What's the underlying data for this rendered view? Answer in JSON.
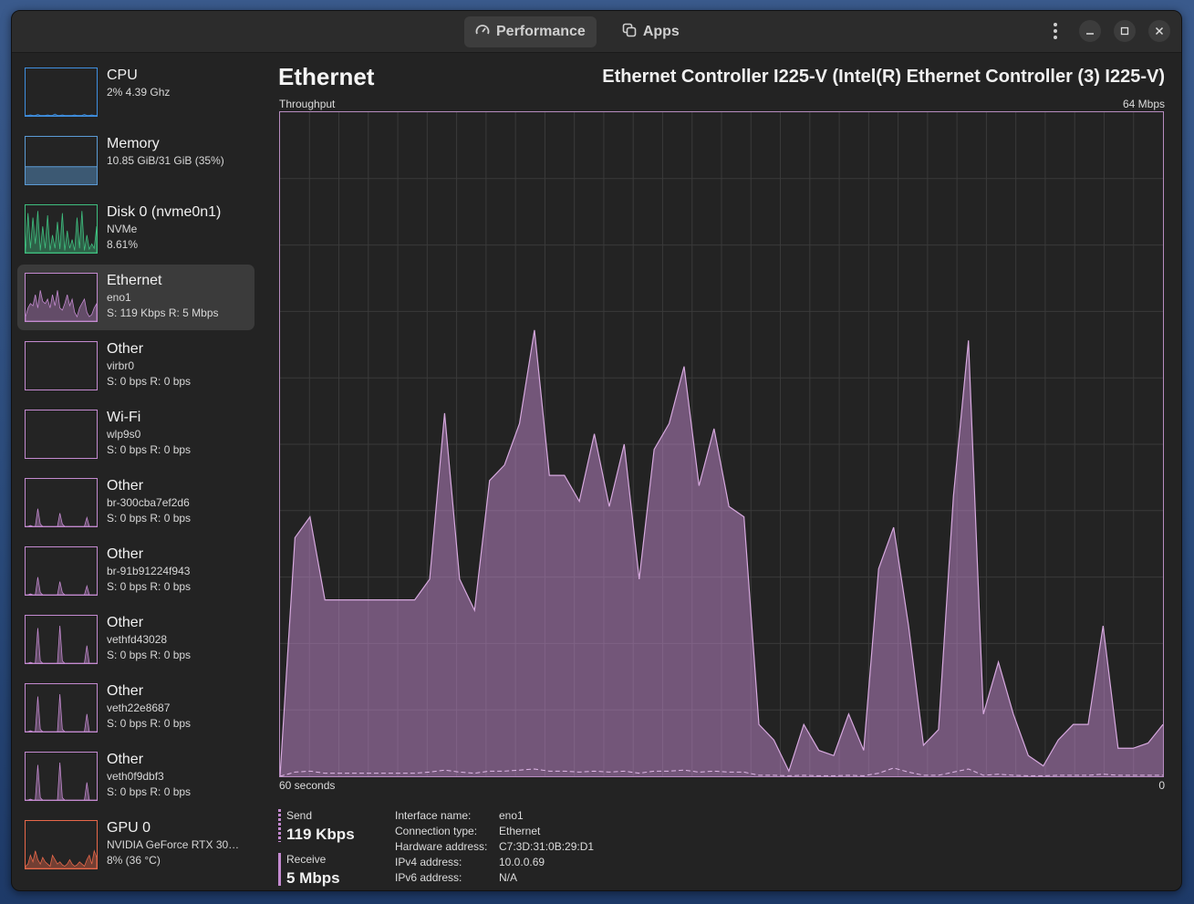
{
  "header": {
    "tabs": [
      {
        "label": "Performance",
        "icon": "gauge-icon",
        "active": true
      },
      {
        "label": "Apps",
        "icon": "apps-icon",
        "active": false
      }
    ]
  },
  "sidebar": {
    "items": [
      {
        "title": "CPU",
        "sub1": "2% 4.39 Ghz",
        "sub2": "",
        "color": "#3f8fe0"
      },
      {
        "title": "Memory",
        "sub1": "10.85 GiB/31 GiB (35%)",
        "sub2": "",
        "color": "#5b9bd5"
      },
      {
        "title": "Disk 0 (nvme0n1)",
        "sub1": "NVMe",
        "sub2": "8.61%",
        "color": "#3fbf7f"
      },
      {
        "title": "Ethernet",
        "sub1": "eno1",
        "sub2": "S: 119 Kbps R: 5 Mbps",
        "color": "#c48ad0"
      },
      {
        "title": "Other",
        "sub1": "virbr0",
        "sub2": "S: 0 bps R: 0 bps",
        "color": "#c48ad0"
      },
      {
        "title": "Wi-Fi",
        "sub1": "wlp9s0",
        "sub2": "S: 0 bps R: 0 bps",
        "color": "#c48ad0"
      },
      {
        "title": "Other",
        "sub1": "br-300cba7ef2d6",
        "sub2": "S: 0 bps R: 0 bps",
        "color": "#c48ad0"
      },
      {
        "title": "Other",
        "sub1": "br-91b91224f943",
        "sub2": "S: 0 bps R: 0 bps",
        "color": "#c48ad0"
      },
      {
        "title": "Other",
        "sub1": "vethfd43028",
        "sub2": "S: 0 bps R: 0 bps",
        "color": "#c48ad0"
      },
      {
        "title": "Other",
        "sub1": "veth22e8687",
        "sub2": "S: 0 bps R: 0 bps",
        "color": "#c48ad0"
      },
      {
        "title": "Other",
        "sub1": "veth0f9dbf3",
        "sub2": "S: 0 bps R: 0 bps",
        "color": "#c48ad0"
      },
      {
        "title": "GPU 0",
        "sub1": "NVIDIA GeForce RTX 30…",
        "sub2": "8% (36 °C)",
        "color": "#e8684a"
      }
    ]
  },
  "main": {
    "title": "Ethernet",
    "device": "Ethernet Controller I225-V (Intel(R) Ethernet Controller (3) I225-V)",
    "throughput_label": "Throughput",
    "max_label": "64 Mbps",
    "time_label": "60 seconds",
    "zero_label": "0",
    "accent_color": "#c48ad0"
  },
  "stats": {
    "send_label": "Send",
    "send_value": "119 Kbps",
    "receive_label": "Receive",
    "receive_value": "5 Mbps"
  },
  "info": [
    {
      "key": "Interface name:",
      "value": "eno1"
    },
    {
      "key": "Connection type:",
      "value": "Ethernet"
    },
    {
      "key": "Hardware address:",
      "value": "C7:3D:31:0B:29:D1"
    },
    {
      "key": "IPv4 address:",
      "value": "10.0.0.69"
    },
    {
      "key": "IPv6 address:",
      "value": "N/A"
    }
  ],
  "chart_data": {
    "type": "area",
    "title": "Throughput",
    "xlabel": "60 seconds",
    "ylim": [
      0,
      64
    ],
    "grid": true,
    "series": [
      {
        "name": "Receive",
        "values": [
          0,
          23,
          25,
          17,
          17,
          17,
          17,
          17,
          17,
          17,
          19,
          35,
          19,
          16,
          28.5,
          30,
          34,
          43,
          29,
          29,
          26.5,
          33,
          26,
          32,
          19,
          31.5,
          34,
          39.5,
          28,
          33.5,
          26,
          25,
          5,
          3.5,
          0.5,
          5,
          2.5,
          2,
          6,
          2.5,
          20,
          24,
          14.5,
          3,
          4.5,
          27,
          42,
          6,
          11,
          6,
          2,
          1,
          3.5,
          5,
          5,
          14.5,
          2.7,
          2.7,
          3.2,
          5
        ]
      },
      {
        "name": "Send",
        "values": [
          0,
          0.4,
          0.5,
          0.3,
          0.3,
          0.3,
          0.3,
          0.3,
          0.3,
          0.3,
          0.4,
          0.6,
          0.4,
          0.3,
          0.5,
          0.5,
          0.6,
          0.7,
          0.5,
          0.5,
          0.4,
          0.5,
          0.4,
          0.5,
          0.3,
          0.5,
          0.5,
          0.6,
          0.4,
          0.5,
          0.4,
          0.4,
          0.1,
          0.1,
          0.05,
          0.1,
          0.05,
          0.05,
          0.1,
          0.05,
          0.3,
          0.8,
          0.4,
          0.1,
          0.1,
          0.4,
          0.7,
          0.1,
          0.2,
          0.1,
          0.05,
          0.05,
          0.1,
          0.1,
          0.1,
          0.2,
          0.1,
          0.1,
          0.1,
          0.1
        ]
      }
    ]
  }
}
